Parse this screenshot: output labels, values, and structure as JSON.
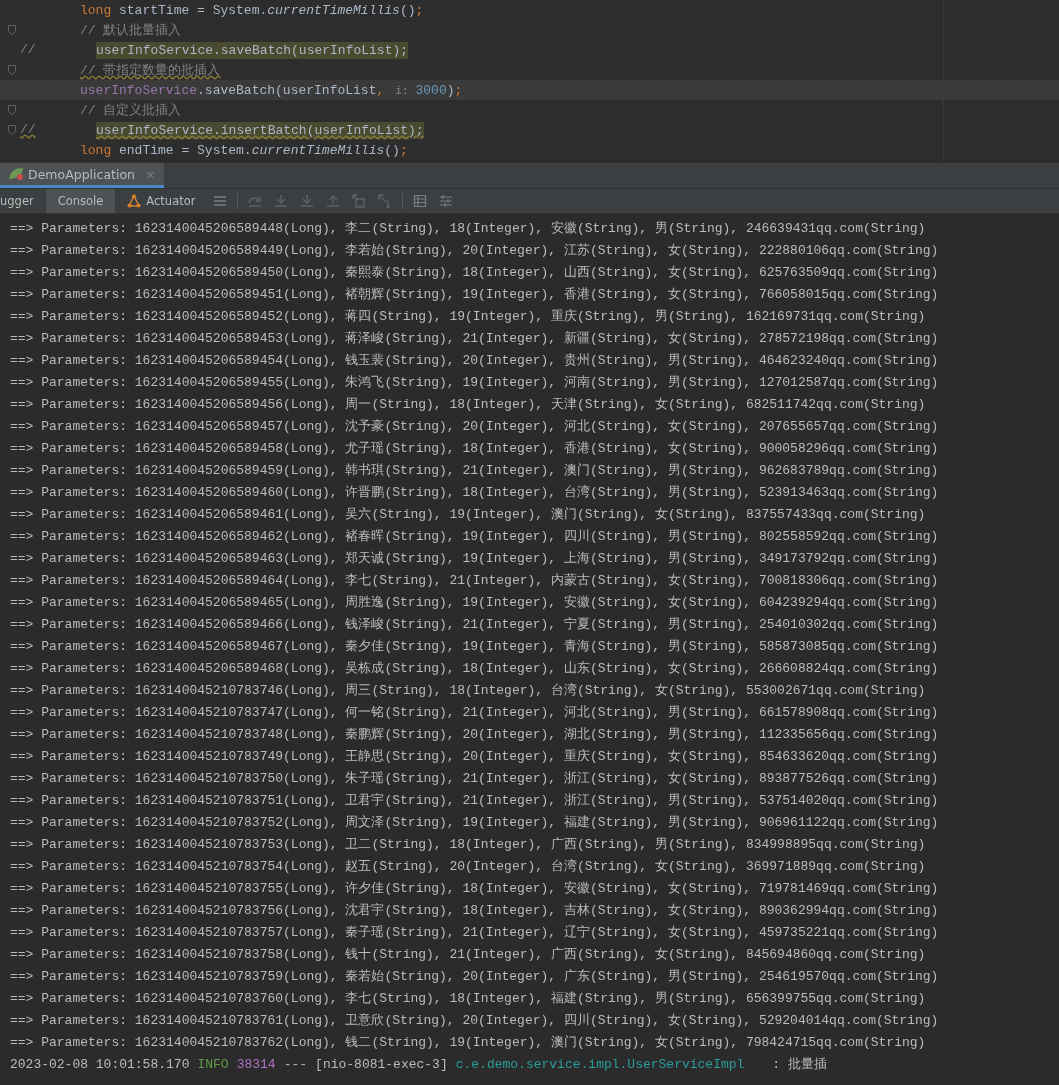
{
  "editor": {
    "lines": [
      {
        "fold": false,
        "highlighted": false,
        "current": false,
        "warning": false,
        "segments": [
          {
            "kind": "keyword",
            "text": "long"
          },
          {
            "kind": "plain",
            "text": " startTime = System."
          },
          {
            "kind": "italic",
            "text": "currentTimeMillis"
          },
          {
            "kind": "plain",
            "text": "()"
          },
          {
            "kind": "keyword",
            "text": ";"
          }
        ]
      },
      {
        "fold": true,
        "highlighted": false,
        "current": false,
        "warning": false,
        "segments": [
          {
            "kind": "comment",
            "text": "// 默认批量插入"
          }
        ]
      },
      {
        "fold": false,
        "prefix": "//",
        "highlighted": true,
        "current": false,
        "warning": false,
        "segments": [
          {
            "kind": "plain",
            "text": "userInfoService.saveBatch(userInfoList);"
          }
        ]
      },
      {
        "fold": true,
        "highlighted": false,
        "current": false,
        "warning": true,
        "segments": [
          {
            "kind": "comment",
            "text": "// 带指定数量的批插入"
          }
        ]
      },
      {
        "fold": false,
        "highlighted": false,
        "current": true,
        "warning": false,
        "segments": [
          {
            "kind": "field",
            "text": "userInfoService"
          },
          {
            "kind": "plain",
            "text": ".saveBatch(userInfoList"
          },
          {
            "kind": "keyword",
            "text": ","
          },
          {
            "kind": "hint",
            "text": "i:"
          },
          {
            "kind": "number",
            "text": "3000"
          },
          {
            "kind": "plain",
            "text": ")"
          },
          {
            "kind": "keyword",
            "text": ";"
          }
        ]
      },
      {
        "fold": true,
        "highlighted": false,
        "current": false,
        "warning": false,
        "segments": [
          {
            "kind": "comment",
            "text": "// 自定义批插入"
          }
        ]
      },
      {
        "fold": true,
        "prefix": "//",
        "highlighted": true,
        "current": false,
        "warning": true,
        "segments": [
          {
            "kind": "plain",
            "text": "userInfoService.insertBatch(userInfoList);"
          }
        ]
      },
      {
        "fold": false,
        "highlighted": false,
        "current": false,
        "warning": false,
        "segments": [
          {
            "kind": "keyword",
            "text": "long"
          },
          {
            "kind": "plain",
            "text": " endTime = System."
          },
          {
            "kind": "italic",
            "text": "currentTimeMillis"
          },
          {
            "kind": "plain",
            "text": "()"
          },
          {
            "kind": "keyword",
            "text": ";"
          }
        ]
      }
    ]
  },
  "run_tabs": [
    {
      "label": "DemoApplication",
      "close": "×",
      "selected": true
    }
  ],
  "tool_tabs": [
    {
      "label": "ugger",
      "kind": "plain",
      "selected": false
    },
    {
      "label": "Console",
      "kind": "plain",
      "selected": true
    },
    {
      "label": "Actuator",
      "kind": "with-icon",
      "selected": false
    }
  ],
  "console": {
    "lines": [
      "==> Parameters: 1623140045206589448(Long), 李二(String), 18(Integer), 安徽(String), 男(String), 246639431qq.com(String)",
      "==> Parameters: 1623140045206589449(Long), 李若始(String), 20(Integer), 江苏(String), 女(String), 222880106qq.com(String)",
      "==> Parameters: 1623140045206589450(Long), 秦熙泰(String), 18(Integer), 山西(String), 女(String), 625763509qq.com(String)",
      "==> Parameters: 1623140045206589451(Long), 褚朝辉(String), 19(Integer), 香港(String), 女(String), 766058015qq.com(String)",
      "==> Parameters: 1623140045206589452(Long), 蒋四(String), 19(Integer), 重庆(String), 男(String), 162169731qq.com(String)",
      "==> Parameters: 1623140045206589453(Long), 蒋泽峻(String), 21(Integer), 新疆(String), 女(String), 278572198qq.com(String)",
      "==> Parameters: 1623140045206589454(Long), 钱玉裴(String), 20(Integer), 贵州(String), 男(String), 464623240qq.com(String)",
      "==> Parameters: 1623140045206589455(Long), 朱鸿飞(String), 19(Integer), 河南(String), 男(String), 127012587qq.com(String)",
      "==> Parameters: 1623140045206589456(Long), 周一(String), 18(Integer), 天津(String), 女(String), 682511742qq.com(String)",
      "==> Parameters: 1623140045206589457(Long), 沈予豪(String), 20(Integer), 河北(String), 女(String), 207655657qq.com(String)",
      "==> Parameters: 1623140045206589458(Long), 尤子瑶(String), 18(Integer), 香港(String), 女(String), 900058296qq.com(String)",
      "==> Parameters: 1623140045206589459(Long), 韩书琪(String), 21(Integer), 澳门(String), 男(String), 962683789qq.com(String)",
      "==> Parameters: 1623140045206589460(Long), 许晋鹏(String), 18(Integer), 台湾(String), 男(String), 523913463qq.com(String)",
      "==> Parameters: 1623140045206589461(Long), 吴六(String), 19(Integer), 澳门(String), 女(String), 837557433qq.com(String)",
      "==> Parameters: 1623140045206589462(Long), 褚春晖(String), 19(Integer), 四川(String), 男(String), 802558592qq.com(String)",
      "==> Parameters: 1623140045206589463(Long), 郑天诚(String), 19(Integer), 上海(String), 男(String), 349173792qq.com(String)",
      "==> Parameters: 1623140045206589464(Long), 李七(String), 21(Integer), 内蒙古(String), 女(String), 700818306qq.com(String)",
      "==> Parameters: 1623140045206589465(Long), 周胜逸(String), 19(Integer), 安徽(String), 女(String), 604239294qq.com(String)",
      "==> Parameters: 1623140045206589466(Long), 钱泽峻(String), 21(Integer), 宁夏(String), 男(String), 254010302qq.com(String)",
      "==> Parameters: 1623140045206589467(Long), 秦夕佳(String), 19(Integer), 青海(String), 男(String), 585873085qq.com(String)",
      "==> Parameters: 1623140045206589468(Long), 吴栋成(String), 18(Integer), 山东(String), 女(String), 266608824qq.com(String)",
      "==> Parameters: 1623140045210783746(Long), 周三(String), 18(Integer), 台湾(String), 女(String), 553002671qq.com(String)",
      "==> Parameters: 1623140045210783747(Long), 何一铭(String), 21(Integer), 河北(String), 男(String), 661578908qq.com(String)",
      "==> Parameters: 1623140045210783748(Long), 秦鹏辉(String), 20(Integer), 湖北(String), 男(String), 112335656qq.com(String)",
      "==> Parameters: 1623140045210783749(Long), 王静思(String), 20(Integer), 重庆(String), 女(String), 854633620qq.com(String)",
      "==> Parameters: 1623140045210783750(Long), 朱子瑶(String), 21(Integer), 浙江(String), 女(String), 893877526qq.com(String)",
      "==> Parameters: 1623140045210783751(Long), 卫君宇(String), 21(Integer), 浙江(String), 男(String), 537514020qq.com(String)",
      "==> Parameters: 1623140045210783752(Long), 周文泽(String), 19(Integer), 福建(String), 男(String), 906961122qq.com(String)",
      "==> Parameters: 1623140045210783753(Long), 卫二(String), 18(Integer), 广西(String), 男(String), 834998895qq.com(String)",
      "==> Parameters: 1623140045210783754(Long), 赵五(String), 20(Integer), 台湾(String), 女(String), 369971889qq.com(String)",
      "==> Parameters: 1623140045210783755(Long), 许夕佳(String), 18(Integer), 安徽(String), 女(String), 719781469qq.com(String)",
      "==> Parameters: 1623140045210783756(Long), 沈君宇(String), 18(Integer), 吉林(String), 女(String), 890362994qq.com(String)",
      "==> Parameters: 1623140045210783757(Long), 秦子瑶(String), 21(Integer), 辽宁(String), 女(String), 459735221qq.com(String)",
      "==> Parameters: 1623140045210783758(Long), 钱十(String), 21(Integer), 广西(String), 女(String), 845694860qq.com(String)",
      "==> Parameters: 1623140045210783759(Long), 秦若始(String), 20(Integer), 广东(String), 男(String), 254619570qq.com(String)",
      "==> Parameters: 1623140045210783760(Long), 李七(String), 18(Integer), 福建(String), 男(String), 656399755qq.com(String)",
      "==> Parameters: 1623140045210783761(Long), 卫意欣(String), 20(Integer), 四川(String), 女(String), 529204014qq.com(String)",
      "==> Parameters: 1623140045210783762(Long), 钱二(String), 19(Integer), 澳门(String), 女(String), 798424715qq.com(String)"
    ],
    "log_line": [
      {
        "kind": "time",
        "text": "2023-02-08 10:01:58.170"
      },
      {
        "kind": "level",
        "text": "INFO"
      },
      {
        "kind": "pid",
        "text": "38314"
      },
      {
        "kind": "plain",
        "text": "---"
      },
      {
        "kind": "plain",
        "text": "[nio-8081-exec-3]"
      },
      {
        "kind": "logger",
        "text": "c.e.demo.service.impl.UserServiceImpl"
      },
      {
        "kind": "message",
        "text": ": 批量插"
      }
    ]
  }
}
